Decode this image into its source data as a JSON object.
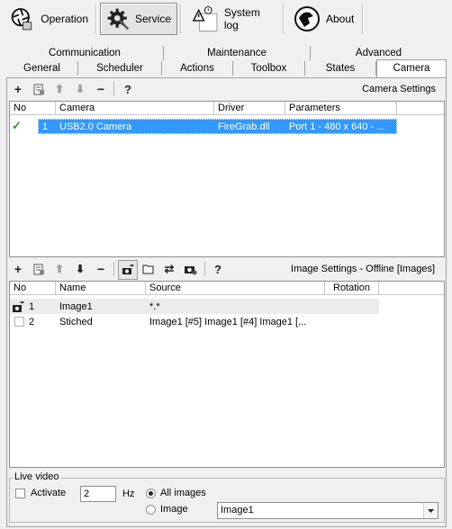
{
  "topbar": {
    "operation": "Operation",
    "service": "Service",
    "system_log": "System log",
    "about": "About"
  },
  "tabs_row1": [
    "Communication",
    "Maintenance",
    "Advanced"
  ],
  "tabs_row2": [
    "General",
    "Scheduler",
    "Actions",
    "Toolbox",
    "States",
    "Camera"
  ],
  "selected_tab": "Camera",
  "camera_section": {
    "title": "Camera Settings",
    "columns": [
      "No",
      "Camera",
      "Driver",
      "Parameters"
    ],
    "rows": [
      {
        "no": "1",
        "camera": "USB2.0 Camera",
        "driver": "FireGrab.dll",
        "parameters": "Port 1 - 480 x 640 - ...",
        "checked": true
      }
    ]
  },
  "image_section": {
    "title": "Image Settings - Offline [Images]",
    "columns": [
      "No",
      "Name",
      "Source",
      "Rotation"
    ],
    "rows": [
      {
        "no": "1",
        "name": "Image1",
        "source": "*.*"
      },
      {
        "no": "2",
        "name": "Stiched",
        "source": "Image1 [#5] Image1 [#4] Image1 [..."
      }
    ]
  },
  "live_video": {
    "legend": "Live video",
    "activate_label": "Activate",
    "activate_checked": false,
    "hz_value": "2",
    "hz_label": "Hz",
    "all_images_label": "All images",
    "all_images_selected": true,
    "image_label": "Image",
    "image_select_value": "Image1"
  },
  "colors": {
    "selection": "#3399ff",
    "check": "#2e9a2e"
  }
}
